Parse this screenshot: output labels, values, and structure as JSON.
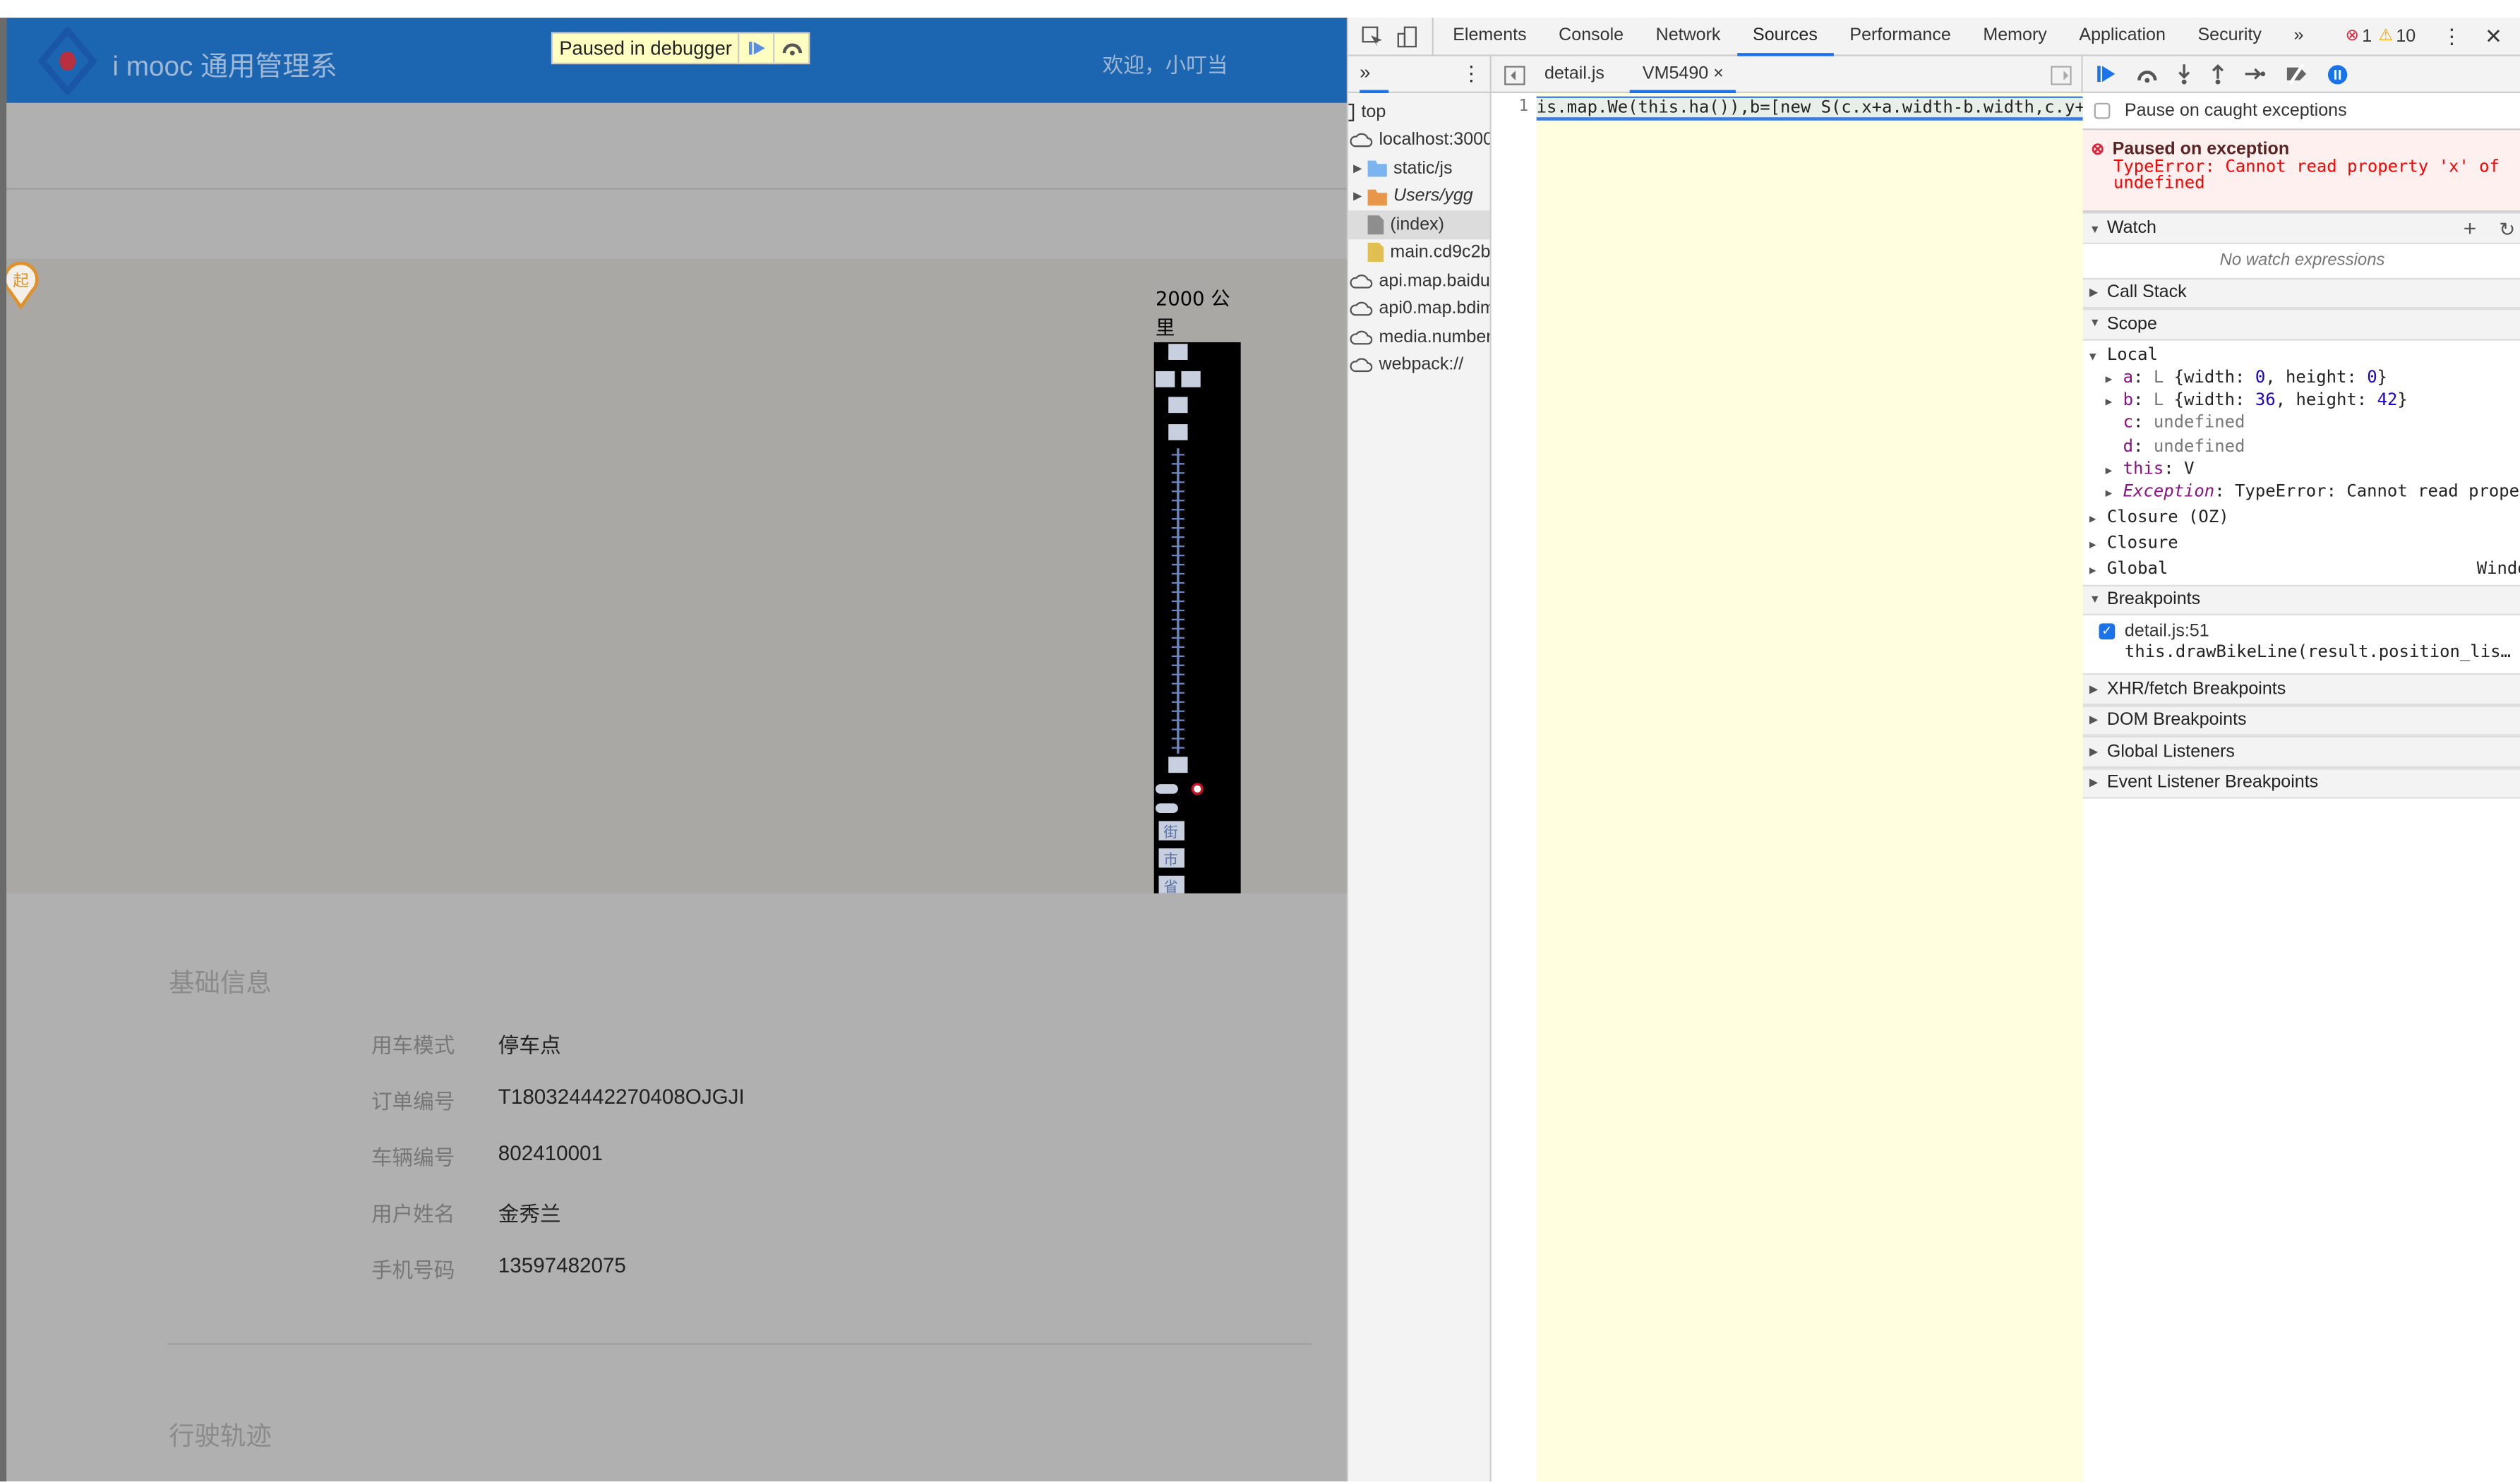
{
  "app": {
    "title": "i mooc 通用管理系",
    "welcome": "欢迎，小叮当",
    "debugger_banner": "Paused in debugger"
  },
  "map": {
    "scale_label": "2000 公里",
    "start_marker": "起",
    "zoom_levels": [
      "街",
      "市",
      "省"
    ]
  },
  "info": {
    "section_title": "基础信息",
    "fields": [
      {
        "label": "用车模式",
        "value": "停车点"
      },
      {
        "label": "订单编号",
        "value": "T180324442270408OJGJI"
      },
      {
        "label": "车辆编号",
        "value": "802410001"
      },
      {
        "label": "用户姓名",
        "value": "金秀兰"
      },
      {
        "label": "手机号码",
        "value": "13597482075"
      }
    ],
    "track_title": "行驶轨迹"
  },
  "devtools": {
    "tabs": [
      "Elements",
      "Console",
      "Network",
      "Sources",
      "Performance",
      "Memory",
      "Application",
      "Security"
    ],
    "active_tab": "Sources",
    "error_count": "1",
    "warning_count": "10",
    "file_tabs": [
      {
        "label": "detail.js"
      },
      {
        "label": "VM5490",
        "active": true
      }
    ],
    "navigator": [
      {
        "label": "top",
        "icon": "frame"
      },
      {
        "label": "localhost:3000",
        "icon": "cloud"
      },
      {
        "label": "static/js",
        "icon": "folder-blue"
      },
      {
        "label": "Users/ygg",
        "icon": "folder-orange"
      },
      {
        "label": "(index)",
        "icon": "file-gray"
      },
      {
        "label": "main.cd9c2b",
        "icon": "file-yellow"
      },
      {
        "label": "api.map.baidu.",
        "icon": "cloud"
      },
      {
        "label": "api0.map.bdim",
        "icon": "cloud"
      },
      {
        "label": "media.number-",
        "icon": "cloud"
      },
      {
        "label": "webpack://",
        "icon": "cloud"
      }
    ],
    "code": {
      "line_number": "1",
      "text": "is.map.We(this.ha()),b=[new S(c.x+a.width-b.width,c.y+"
    },
    "pause_caught": "Pause on caught exceptions",
    "exception": {
      "title": "Paused on exception",
      "message": "TypeError: Cannot read property 'x' of undefined"
    },
    "watch": {
      "title": "Watch",
      "empty": "No watch expressions"
    },
    "call_stack": "Call Stack",
    "scope": {
      "title": "Scope",
      "local": "Local",
      "a": {
        "name": "a",
        "type": "L",
        "w": "0",
        "h": "0"
      },
      "b": {
        "name": "b",
        "type": "L",
        "w": "36",
        "h": "42"
      },
      "c": {
        "name": "c",
        "value": "undefined"
      },
      "d": {
        "name": "d",
        "value": "undefined"
      },
      "this": {
        "name": "this",
        "value": "V"
      },
      "exception": {
        "name": "Exception",
        "value": "TypeError: Cannot read prope…"
      },
      "closure_oz": "Closure (OZ)",
      "closure": "Closure",
      "global": "Global",
      "global_value": "Window"
    },
    "breakpoints": {
      "title": "Breakpoints",
      "item_file": "detail.js:51",
      "item_code": "this.drawBikeLine(result.position_lis…"
    },
    "sections": [
      "XHR/fetch Breakpoints",
      "DOM Breakpoints",
      "Global Listeners",
      "Event Listener Breakpoints"
    ]
  },
  "colors": {
    "header": "#1c65b0",
    "accent": "#1a73e8",
    "error": "#ff0000"
  }
}
